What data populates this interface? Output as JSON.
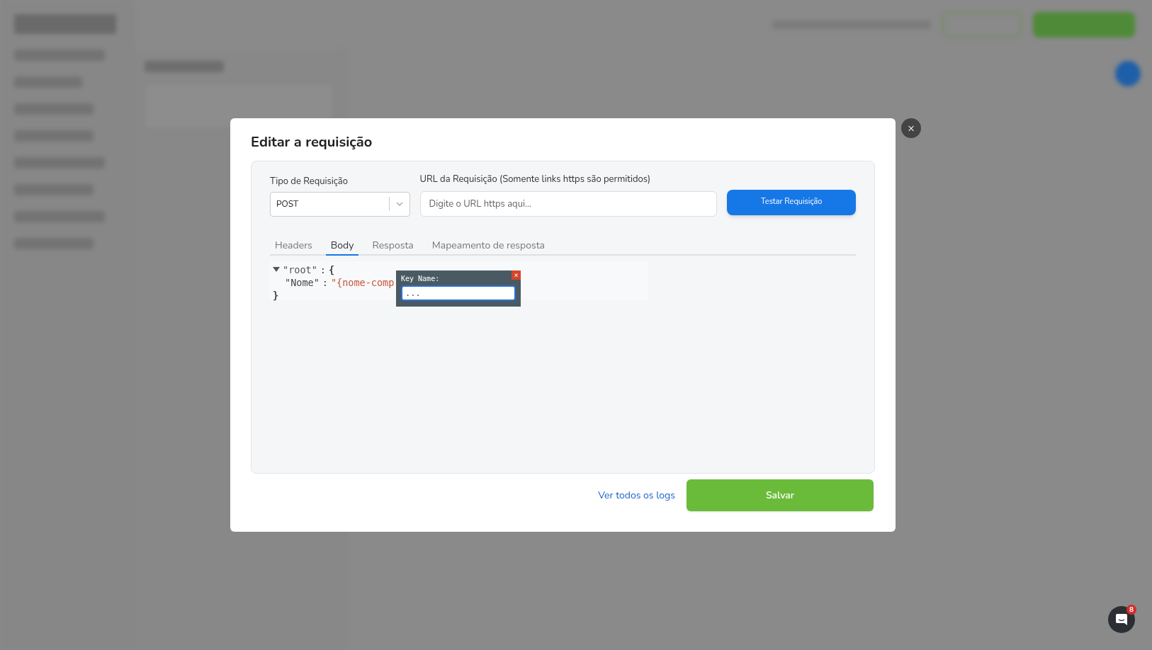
{
  "modal": {
    "title": "Editar a requisição",
    "request_type": {
      "label": "Tipo de Requisição",
      "value": "POST"
    },
    "url": {
      "label": "URL da Requisição (Somente links https são permitidos)",
      "placeholder": "Digite o URL https aqui…"
    },
    "test_button": "Testar Requisição",
    "tabs": [
      {
        "label": "Headers",
        "selected": false
      },
      {
        "label": "Body",
        "selected": true
      },
      {
        "label": "Resposta",
        "selected": false
      },
      {
        "label": "Mapeamento de resposta",
        "selected": false
      }
    ],
    "json_editor": {
      "separator": ":",
      "root_key": "\"root\"",
      "open_brace": "{",
      "close_brace": "}",
      "entries": [
        {
          "key": "\"Nome\"",
          "value": "\"{nome-comp"
        }
      ]
    },
    "key_popup": {
      "label": "Key Name:",
      "value": "...",
      "close": "×"
    },
    "logs_link": "Ver todos os logs",
    "save_button": "Salvar",
    "close": "×"
  },
  "chat_launcher": {
    "badge": "8"
  }
}
